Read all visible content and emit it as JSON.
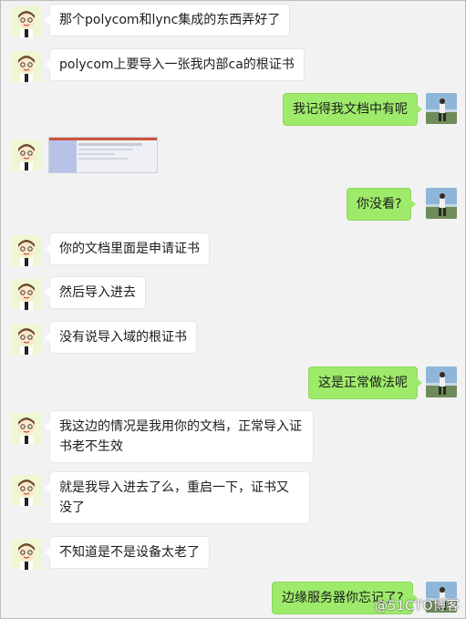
{
  "messages": [
    {
      "side": "left",
      "text": "那个polycom和lync集成的东西弄好了"
    },
    {
      "side": "left",
      "text": "polycom上要导入一张我内部ca的根证书"
    },
    {
      "side": "right",
      "text": "我记得我文档中有呢"
    },
    {
      "side": "left",
      "type": "image"
    },
    {
      "side": "right",
      "text": "你没看?"
    },
    {
      "side": "left",
      "text": "你的文档里面是申请证书"
    },
    {
      "side": "left",
      "text": "然后导入进去"
    },
    {
      "side": "left",
      "text": "没有说导入域的根证书"
    },
    {
      "side": "right",
      "text": "这是正常做法呢"
    },
    {
      "side": "left",
      "text": "我这边的情况是我用你的文档，正常导入证书老不生效"
    },
    {
      "side": "left",
      "text": "就是我导入进去了么，重启一下，证书又没了"
    },
    {
      "side": "left",
      "text": "不知道是不是设备太老了"
    },
    {
      "side": "right",
      "text": "边缘服务器你忘记了?"
    }
  ],
  "watermark": "@51CTO博客",
  "colors": {
    "background": "#f2f2f2",
    "left_bubble": "#ffffff",
    "right_bubble": "#9eea6a"
  },
  "icons": {
    "left_avatar": "cartoon-face-avatar-icon",
    "right_avatar": "photo-avatar-icon"
  }
}
